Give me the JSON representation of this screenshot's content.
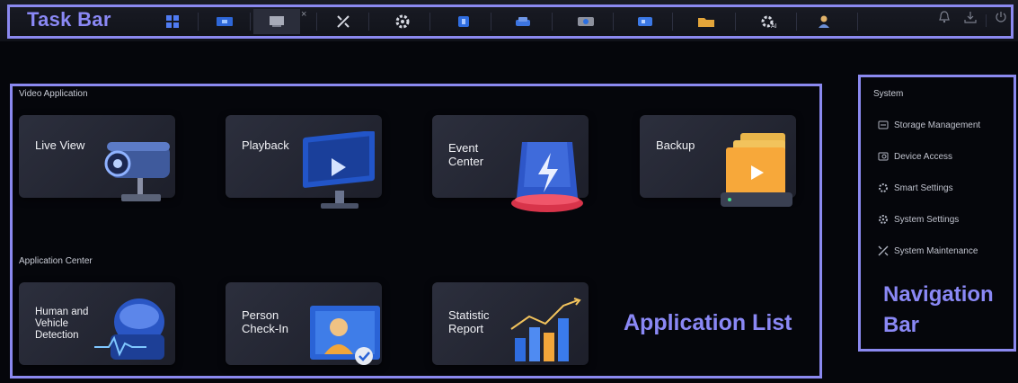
{
  "taskbar": {
    "title": "Task Bar",
    "buttons": [
      {
        "icon": "grid-icon",
        "active": false
      },
      {
        "icon": "live-view-icon",
        "active": false
      },
      {
        "icon": "playback-icon",
        "active": true
      },
      {
        "icon": "tools-icon",
        "active": false
      },
      {
        "icon": "settings-gear-icon",
        "active": false
      },
      {
        "icon": "event-icon",
        "active": false
      },
      {
        "icon": "vehicle-icon",
        "active": false
      },
      {
        "icon": "camera-icon",
        "active": false
      },
      {
        "icon": "video-icon",
        "active": false
      },
      {
        "icon": "folder-icon",
        "active": false
      },
      {
        "icon": "ai-settings-icon",
        "active": false
      },
      {
        "icon": "user-icon",
        "active": false
      }
    ],
    "close_glyph": "×",
    "right_icons": [
      "bell-icon",
      "download-icon",
      "power-icon"
    ]
  },
  "app_list": {
    "title": "Application List",
    "video_section": {
      "label": "Video Application",
      "cards": [
        {
          "label": "Live View",
          "art": "camera-art"
        },
        {
          "label": "Playback",
          "art": "monitor-art"
        },
        {
          "label": "Event\nCenter",
          "art": "alarm-art"
        },
        {
          "label": "Backup",
          "art": "folder-art"
        }
      ]
    },
    "application_section": {
      "label": "Application Center",
      "cards": [
        {
          "label": "Human and\nVehicle\nDetection",
          "art": "robot-art"
        },
        {
          "label": "Person\nCheck-In",
          "art": "person-art"
        },
        {
          "label": "Statistic\nReport",
          "art": "chart-art"
        }
      ]
    }
  },
  "navigation": {
    "section": "System",
    "items": [
      {
        "label": "Storage Management",
        "icon": "storage-icon"
      },
      {
        "label": "Device Access",
        "icon": "device-icon"
      },
      {
        "label": "Smart Settings",
        "icon": "smart-gear-icon"
      },
      {
        "label": "System Settings",
        "icon": "system-gear-icon"
      },
      {
        "label": "System Maintenance",
        "icon": "maintenance-icon"
      }
    ],
    "title": "Navigation\nBar"
  },
  "colors": {
    "annotation": "#8b89f0",
    "accent_blue": "#3d6cf0",
    "background": "#05060b"
  }
}
